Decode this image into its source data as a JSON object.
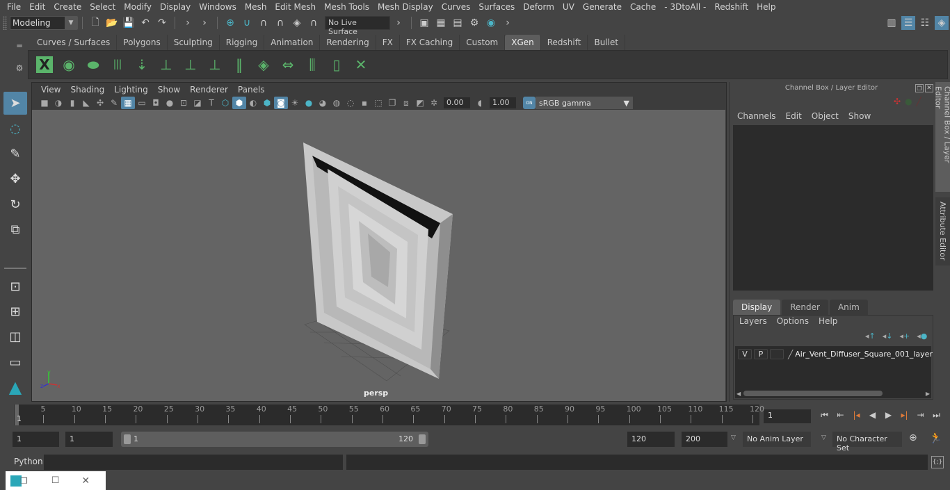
{
  "menubar": {
    "items": [
      "File",
      "Edit",
      "Create",
      "Select",
      "Modify",
      "Display",
      "Windows",
      "Mesh",
      "Edit Mesh",
      "Mesh Tools",
      "Mesh Display",
      "Curves",
      "Surfaces",
      "Deform",
      "UV",
      "Generate",
      "Cache",
      "- 3DtoAll -",
      "Redshift",
      "Help"
    ]
  },
  "statusline": {
    "mode": "Modeling",
    "live_surface": "No Live Surface"
  },
  "shelf": {
    "tabs": [
      "Curves / Surfaces",
      "Polygons",
      "Sculpting",
      "Rigging",
      "Animation",
      "Rendering",
      "FX",
      "FX Caching",
      "Custom",
      "XGen",
      "Redshift",
      "Bullet"
    ],
    "active_tab": "XGen",
    "icons": [
      "xgen-description-editor-icon",
      "xgen-preview-icon",
      "xgen-clear-preview-icon",
      "xgen-add-guides-icon",
      "xgen-place-guides-icon",
      "xgen-add-guide-icon",
      "xgen-show-guides-icon",
      "xgen-lock-guides-icon",
      "xgen-split-guides-icon",
      "xgen-patches-icon",
      "xgen-sculpt-guides-icon",
      "xgen-select-icon",
      "xgen-bounding-icon",
      "xgen-delete-guides-icon"
    ]
  },
  "panel": {
    "menu": [
      "View",
      "Shading",
      "Lighting",
      "Show",
      "Renderer",
      "Panels"
    ],
    "exposure": "0.00",
    "gamma": "1.00",
    "color_space": "sRGB gamma",
    "color_mgmt": "ON",
    "camera_label": "persp",
    "axis": {
      "x": "x",
      "y": "y",
      "z": "z"
    }
  },
  "channel_box": {
    "title": "Channel Box / Layer Editor",
    "menu": [
      "Channels",
      "Edit",
      "Object",
      "Show"
    ]
  },
  "layer_editor": {
    "tabs": [
      "Display",
      "Render",
      "Anim"
    ],
    "active_tab": "Display",
    "menu": [
      "Layers",
      "Options",
      "Help"
    ],
    "layers": [
      {
        "v": "V",
        "p": "P",
        "name": "Air_Vent_Diffuser_Square_001_layer"
      }
    ]
  },
  "side_tabs": [
    "Channel Box / Layer Editor",
    "Attribute Editor"
  ],
  "timeline": {
    "ticks": [
      5,
      10,
      15,
      20,
      25,
      30,
      35,
      40,
      45,
      50,
      55,
      60,
      65,
      70,
      75,
      80,
      85,
      90,
      95,
      100,
      105,
      110,
      115,
      120
    ],
    "start_marker": "1",
    "current_frame": "1",
    "current_frame_fraction": 0.0
  },
  "range": {
    "start": "1",
    "playback_start": "1",
    "range_start": "1",
    "range_end": "120",
    "playback_end": "120",
    "end": "200",
    "anim_layer": "No Anim Layer",
    "character_set": "No Character Set"
  },
  "command_line": {
    "label": "Python",
    "value": ""
  },
  "colors": {
    "accent": "#5285a6",
    "xgen_green": "#5bb46b",
    "teal": "#2aa7b8"
  }
}
